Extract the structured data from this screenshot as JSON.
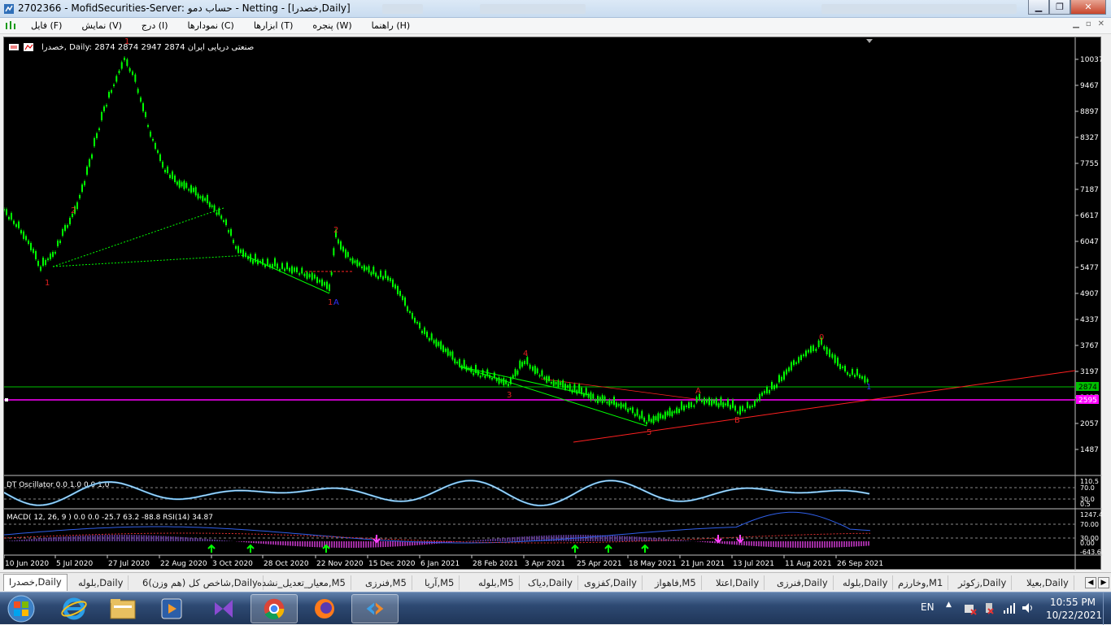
{
  "window": {
    "title": "2702366 - MofidSecurities-Server: حساب دمو - Netting - [خصدرا,Daily]",
    "buttons": {
      "minimize": "▁",
      "maximize": "❐",
      "close": "✕"
    }
  },
  "menu": {
    "items": [
      "فایل (F)",
      "نمایش (V)",
      "درج (I)",
      "نمودارها (C)",
      "ابزارها (T)",
      "پنجره (W)",
      "راهنما (H)"
    ],
    "mdi": {
      "minimize": "▁",
      "restore": "▫",
      "close": "✕"
    }
  },
  "chart": {
    "header": "خصدرا, Daily:  2874 2874 2947 2874  صنعتی دریایی ایران",
    "price_axis": [
      "10037",
      "9467",
      "8897",
      "8327",
      "7755",
      "7187",
      "6617",
      "6047",
      "5477",
      "4907",
      "4337",
      "3767",
      "3197",
      "2627",
      "2057",
      "1487"
    ],
    "price_labels": {
      "current": "2874",
      "line": "2595"
    },
    "time_axis": [
      "10 Jun 2020",
      "5 Jul 2020",
      "27 Jul 2020",
      "22 Aug 2020",
      "3 Oct 2020",
      "28 Oct 2020",
      "22 Nov 2020",
      "15 Dec 2020",
      "6 Jan 2021",
      "28 Feb 2021",
      "3 Apr 2021",
      "25 Apr 2021",
      "18 May 2021",
      "21 Jun 2021",
      "13 Jul 2021",
      "11 Aug 2021",
      "26 Sep 2021"
    ],
    "wave_labels": [
      {
        "text": "1",
        "color": "#e02020"
      },
      {
        "text": "2",
        "color": "#e02020"
      },
      {
        "text": "1",
        "color": "#e02020"
      },
      {
        "text": "2",
        "color": "#e02020"
      },
      {
        "text": "1",
        "color": "#e02020"
      },
      {
        "text": "A",
        "color": "#3030ff"
      },
      {
        "text": "4",
        "color": "#e02020"
      },
      {
        "text": "3",
        "color": "#e02020"
      },
      {
        "text": "5",
        "color": "#e02020"
      },
      {
        "text": "A",
        "color": "#e02020"
      },
      {
        "text": "B",
        "color": "#e02020"
      },
      {
        "text": "0",
        "color": "#e02020"
      },
      {
        "text": "1",
        "color": "#3030ff"
      }
    ],
    "dt_panel": {
      "label": "DT Oscillator 0.0 1.0 0.0 1.0",
      "axis": [
        "110.5",
        "70.0",
        "30.0",
        "0.5"
      ]
    },
    "macd_panel": {
      "label": "MACD( 12, 26, 9 ) 0.0 0.0 -25.7 63.2 -88.8 RSI(14) 34.87",
      "axis": [
        "1247.4",
        "70.00",
        "30.00",
        "0.00",
        "-643.6"
      ]
    },
    "colors": {
      "background": "#000000",
      "bull_candle": "#00ff00",
      "current_line": "#00ff00",
      "magenta_line": "#ff00ff",
      "trendline": "#ff2020",
      "oscillator": "#4aa3e0"
    }
  },
  "tabs": [
    "خصدرا,Daily",
    "بلوله,Daily",
    "شاخص کل (هم وزن)6,Daily",
    "معیار_تعدیل_نشده,M5",
    "فنرزی,M5",
    "آریا,M5",
    "بلوله,M5",
    "دیاک,Daily",
    "کفزوی,Daily",
    "فاهواز,M5",
    "اعتلا,Daily",
    "فنرزی,Daily",
    "بلوله,Daily",
    "وخارزم,M1",
    "زکوثر,Daily",
    "بعیلا,Daily"
  ],
  "taskbar": {
    "language": "EN",
    "time": "10:55 PM",
    "date": "10/22/2021"
  }
}
